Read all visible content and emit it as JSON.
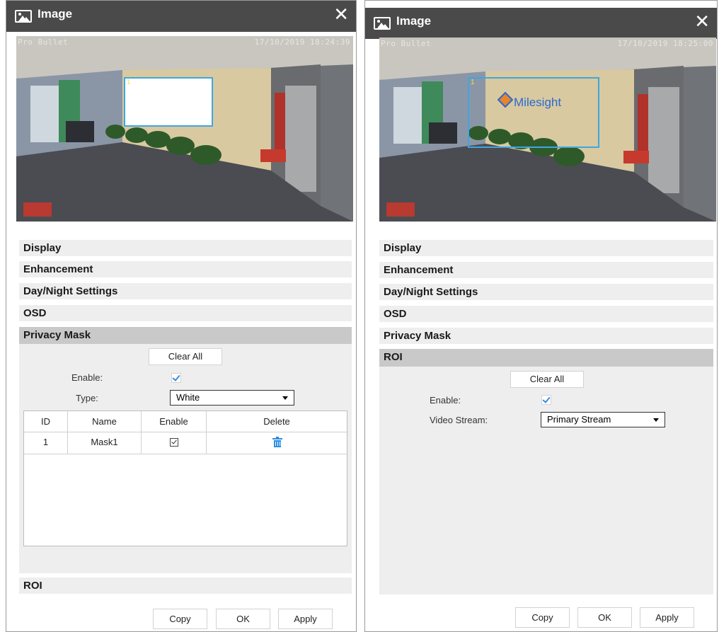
{
  "left_dialog": {
    "title": "Image",
    "title_icon": "image-icon",
    "close_icon": "close-icon",
    "close_glyph": "✕",
    "video": {
      "channel_name": "Pro Bullet",
      "timestamp": "17/10/2019 18:24:39",
      "mask_id": "1"
    },
    "sections": [
      "Display",
      "Enhancement",
      "Day/Night Settings",
      "OSD",
      "Privacy Mask"
    ],
    "active_section": "Privacy Mask",
    "privacy_mask": {
      "clear_all": "Clear All",
      "enable_label": "Enable:",
      "enable_checked": true,
      "type_label": "Type:",
      "type_value": "White",
      "table": {
        "columns": [
          "ID",
          "Name",
          "Enable",
          "Delete"
        ],
        "rows": [
          {
            "id": "1",
            "name": "Mask1",
            "enable": true,
            "delete_icon": "trash-icon"
          }
        ]
      }
    },
    "after_sections": [
      "ROI"
    ],
    "footer": {
      "copy": "Copy",
      "ok": "OK",
      "apply": "Apply"
    }
  },
  "right_dialog": {
    "title": "Image",
    "title_icon": "image-icon",
    "close_icon": "close-icon",
    "close_glyph": "✕",
    "video": {
      "channel_name": "Pro Bullet",
      "timestamp": "17/10/2019 18:25:00",
      "roi_id": "1",
      "logo_text": "Milesight"
    },
    "sections": [
      "Display",
      "Enhancement",
      "Day/Night Settings",
      "OSD",
      "Privacy Mask",
      "ROI"
    ],
    "active_section": "ROI",
    "roi": {
      "clear_all": "Clear All",
      "enable_label": "Enable:",
      "enable_checked": true,
      "stream_label": "Video Stream:",
      "stream_value": "Primary Stream"
    },
    "footer": {
      "copy": "Copy",
      "ok": "OK",
      "apply": "Apply"
    }
  },
  "colors": {
    "titlebar": "#4a4a4a",
    "section_bg": "#eeeeee",
    "active_section_bg": "#c9c9c9",
    "accent": "#3a8be0",
    "roi_box": "#3ea6e0"
  }
}
